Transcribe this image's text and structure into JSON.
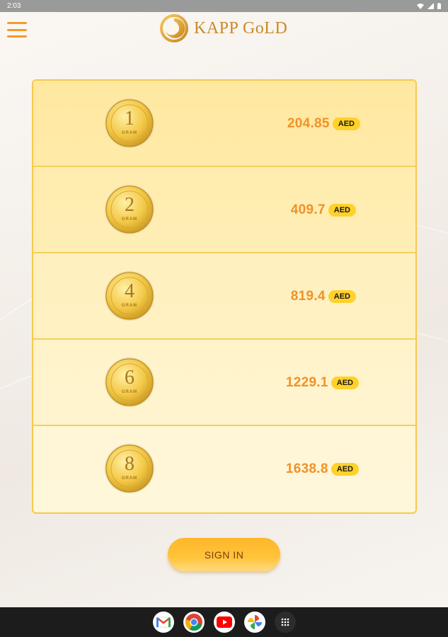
{
  "status_bar": {
    "time": "2:03"
  },
  "header": {
    "logo_text": "KAPP GoLD"
  },
  "products": [
    {
      "grams": "1",
      "unit": "GRAM",
      "price": "204.85",
      "currency": "AED"
    },
    {
      "grams": "2",
      "unit": "GRAM",
      "price": "409.7",
      "currency": "AED"
    },
    {
      "grams": "4",
      "unit": "GRAM",
      "price": "819.4",
      "currency": "AED"
    },
    {
      "grams": "6",
      "unit": "GRAM",
      "price": "1229.1",
      "currency": "AED"
    },
    {
      "grams": "8",
      "unit": "GRAM",
      "price": "1638.8",
      "currency": "AED"
    }
  ],
  "signin": {
    "label": "SIGN IN"
  },
  "nav_apps": [
    "gmail-icon",
    "chrome-icon",
    "youtube-icon",
    "photos-icon",
    "app-drawer-icon"
  ],
  "colors": {
    "accent": "#f29b2b",
    "price": "#f0922a",
    "badge": "#ffd12a"
  }
}
